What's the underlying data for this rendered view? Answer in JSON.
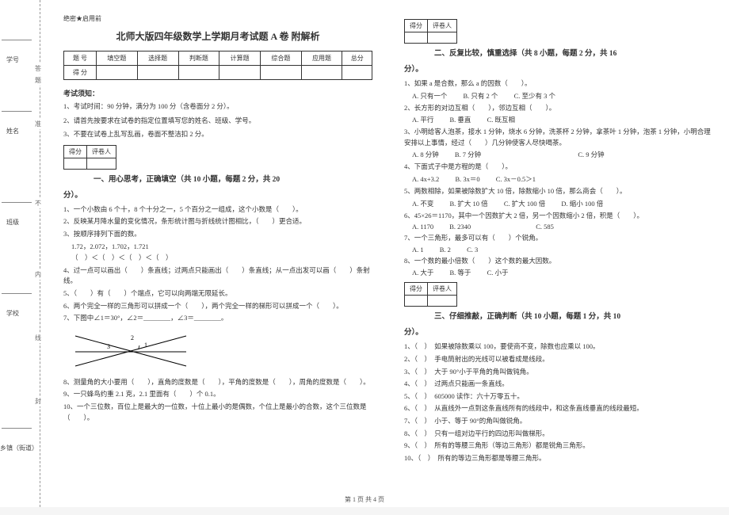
{
  "secret": "绝密★启用前",
  "title": "北师大版四年级数学上学期月考试题 A 卷 附解析",
  "score_table": {
    "row1": [
      "题 号",
      "填空题",
      "选择题",
      "判断题",
      "计算题",
      "综合题",
      "应用题",
      "总分"
    ],
    "row2_head": "得 分"
  },
  "notice": {
    "title": "考试须知：",
    "items": [
      "1、考试时间：90 分钟，满分为 100 分（含卷面分 2 分）。",
      "2、请首先按要求在试卷的指定位置填写您的姓名、班级、学号。",
      "3、不要在试卷上乱写乱画，卷面不整洁扣 2 分。"
    ]
  },
  "mini_table": {
    "c1": "得分",
    "c2": "评卷人"
  },
  "section1": {
    "heading": "一、用心思考，正确填空（共 10 小题，每题 2 分，共 20",
    "heading_tail": "分）。",
    "q1": "1、一个小数由 6 个十，8 个十分之一，5 个百分之一组成，这个小数是（　　）。",
    "q2": "2、反映某月降水量的变化情况，条形统计图与折线统计图相比，（　　）更合适。",
    "q3": "3、按顺序排列下面的数。",
    "q3_nums": "1.72，2.072，1.702，1.721",
    "q3_blank": "（　）＜（　）＜（　）＜（　）",
    "q4": "4、过一点可以画出（　　）条直线；过两点只能画出（　　）条直线；从一点出发可以画（　　）条射线。",
    "q5": "5、（　　）有（　　）个端点，它可以向两端无限延长。",
    "q6": "6、两个完全一样的三角形可以拼成一个（　　），两个完全一样的梯形可以拼成一个（　　）。",
    "q7": "7、下图中∠1＝30°，∠2＝________，∠3＝________。",
    "q8": "8、测量角的大小要用（　　），直角的度数是（　　），平角的度数是（　　），周角的度数是（　　）。",
    "q9": "9、一只蜂鸟约重 2.1 克，2.1 里面有（　　）个 0.1。",
    "q10": "10、一个三位数，百位上是最大的一位数，十位上最小的是偶数，个位上是最小的合数，这个三位数是（　　）。"
  },
  "section2": {
    "heading": "二、反复比较，慎重选择（共 8 小题，每题 2 分，共 16",
    "heading_tail": "分）。",
    "q1": "1、如果 a 是合数，那么 a 的因数（　　）。",
    "q1_opts": [
      "A. 只有一个",
      "B. 只有 2 个",
      "C. 至少有 3 个"
    ],
    "q2": "2、长方形的对边互相（　　），邻边互相（　　）。",
    "q2_opts": [
      "A. 平行",
      "B. 垂直",
      "C. 既互相"
    ],
    "q3": "3、小明给客人泡茶，接水 1 分钟，烧水 6 分钟，洗茶杯 2 分钟，拿茶叶 1 分钟，泡茶 1 分钟，小明合理安排以上事情，经过（　　）几分钟使客人尽快喝茶。",
    "q3_opts": [
      "A. 8 分钟",
      "B. 7 分钟",
      "C. 9 分钟"
    ],
    "q4": "4、下面式子中是方程的是（　　）。",
    "q4_opts": [
      "A. 4x+3.2",
      "B. 3x＝0",
      "C. 3x－0.5＞1"
    ],
    "q5": "5、两数相除，如果被除数扩大 10 倍，除数缩小 10 倍，那么商会（　　）。",
    "q5_opts": [
      "A. 不变",
      "B. 扩大 10 倍",
      "C. 扩大 100 倍",
      "D. 缩小 100 倍"
    ],
    "q6": "6、45×26＝1170，其中一个因数扩大 2 倍，另一个因数缩小 2 倍，积是（　　）。",
    "q6_opts": [
      "A. 1170",
      "B. 2340",
      "C. 585"
    ],
    "q7": "7、一个三角形，最多可以有（　　）个锐角。",
    "q7_opts": [
      "A. 1",
      "B. 2",
      "C. 3"
    ],
    "q8": "8、一个数的最小倍数（　　）这个数的最大因数。",
    "q8_opts": [
      "A. 大于",
      "B. 等于",
      "C. 小于"
    ]
  },
  "section3": {
    "heading": "三、仔细推敲，正确判断（共 10 小题，每题 1 分，共 10",
    "heading_tail": "分）。",
    "q1": "1、（　）　如果被除数乘以 100，要使商不变，除数也应乘以 100。",
    "q2": "2、（　）　手电筒射出的光线可以被看成是线段。",
    "q3": "3、（　）　大于 90°小于平角的角叫做钝角。",
    "q4": "4、（　）　过两点只能画一条直线。",
    "q5": "5、（　）　605000 读作：六十万零五十。",
    "q6": "6、（　）　从直线外一点到这条直线所有的线段中，和这条直线垂直的线段最短。",
    "q7": "7、（　）　小于、等于 90°的角叫做锐角。",
    "q8": "8、（　）　只有一组对边平行的四边形叫做梯形。",
    "q9": "9、（　）　所有的等腰三角形（等边三角形）都是锐角三角形。",
    "q10": "10、（　）　所有的等边三角形都是等腰三角形。"
  },
  "binding": {
    "labels": {
      "town": "乡镇（街道）",
      "school": "学校",
      "class": "班级",
      "name": "姓名",
      "id": "学号"
    },
    "chars": [
      "封",
      "内",
      "不",
      "准",
      "答",
      "题"
    ],
    "hint_chars": [
      "封",
      "线"
    ]
  },
  "footer": "第 1 页 共 4 页"
}
